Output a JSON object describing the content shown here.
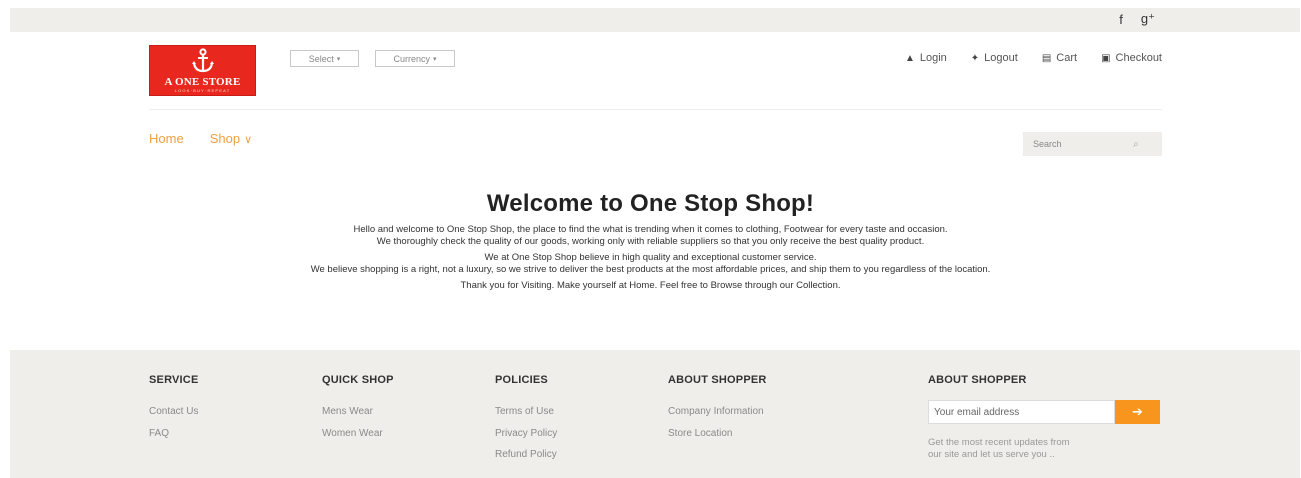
{
  "topbar": {
    "facebook": "f",
    "googleplus": "g⁺"
  },
  "logo": {
    "title": "A ONE STORE",
    "tagline": "LOOK·BUY·REPEAT"
  },
  "selectors": {
    "select_label": "Select",
    "currency_label": "Currency",
    "caret": "▾"
  },
  "usernav": [
    {
      "icon": "▲",
      "label": "Login"
    },
    {
      "icon": "✦",
      "label": "Logout"
    },
    {
      "icon": "▤",
      "label": "Cart"
    },
    {
      "icon": "▣",
      "label": "Checkout"
    }
  ],
  "mainnav": {
    "home": "Home",
    "shop": "Shop",
    "shop_chevron": "∨"
  },
  "search": {
    "placeholder": "Search",
    "icon": "⌕"
  },
  "welcome": {
    "title": "Welcome to One Stop Shop!",
    "p1_line1": "Hello and welcome to One Stop Shop, the place to find the what is trending when it comes to clothing, Footwear for every taste and occasion.",
    "p1_line2": "We thoroughly check the quality of our goods, working only with reliable suppliers so that you only receive the best quality product.",
    "p2_line1": "We at One Stop Shop believe in high quality and exceptional customer service.",
    "p2_line2": "We believe shopping is a right, not a luxury, so we strive to deliver the best products at the most affordable prices, and ship them to you regardless of the location.",
    "p3": "Thank you for Visiting. Make yourself at Home. Feel free to Browse through our Collection."
  },
  "footer": {
    "service": {
      "heading": "SERVICE",
      "links": [
        "Contact Us",
        "FAQ"
      ]
    },
    "quick_shop": {
      "heading": "QUICK SHOP",
      "links": [
        "Mens Wear",
        "Women Wear"
      ]
    },
    "policies": {
      "heading": "POLICIES",
      "links": [
        "Terms of Use",
        "Privacy Policy",
        "Refund Policy"
      ]
    },
    "about": {
      "heading": "ABOUT SHOPPER",
      "links": [
        "Company Information",
        "Store Location"
      ]
    },
    "newsletter": {
      "heading": "ABOUT SHOPPER",
      "placeholder": "Your email address",
      "submit_icon": "➔",
      "desc_line1": "Get the most recent updates from",
      "desc_line2": "our site and let us serve you .."
    }
  },
  "colors": {
    "accent": "#f7951d",
    "logo_red": "#e8281e",
    "nav_orange": "#f0a040",
    "band": "#efeeea"
  }
}
